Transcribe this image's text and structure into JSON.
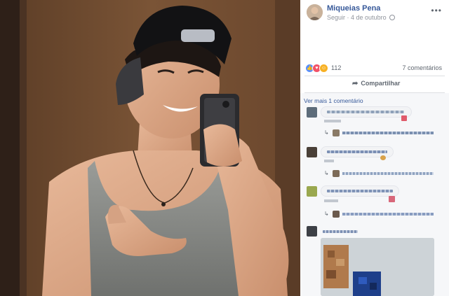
{
  "post": {
    "author": "Miqueias Pena",
    "follow_label": "Seguir",
    "date": "4 de outubro",
    "more_label": "•••"
  },
  "reactions": {
    "count": "112",
    "comments": "7 comentários",
    "types": [
      "like",
      "love",
      "haha"
    ],
    "colors": {
      "like": "#5890ff",
      "love": "#f25268",
      "haha": "#f7b125"
    }
  },
  "actions": {
    "share_label": "Compartilhar"
  },
  "comments_section": {
    "see_more": "Ver mais 1 comentário"
  },
  "theme": {
    "link_color": "#365899",
    "meta_color": "#90949c",
    "panel_bg": "#ffffff",
    "comments_bg": "#f6f7f9"
  }
}
